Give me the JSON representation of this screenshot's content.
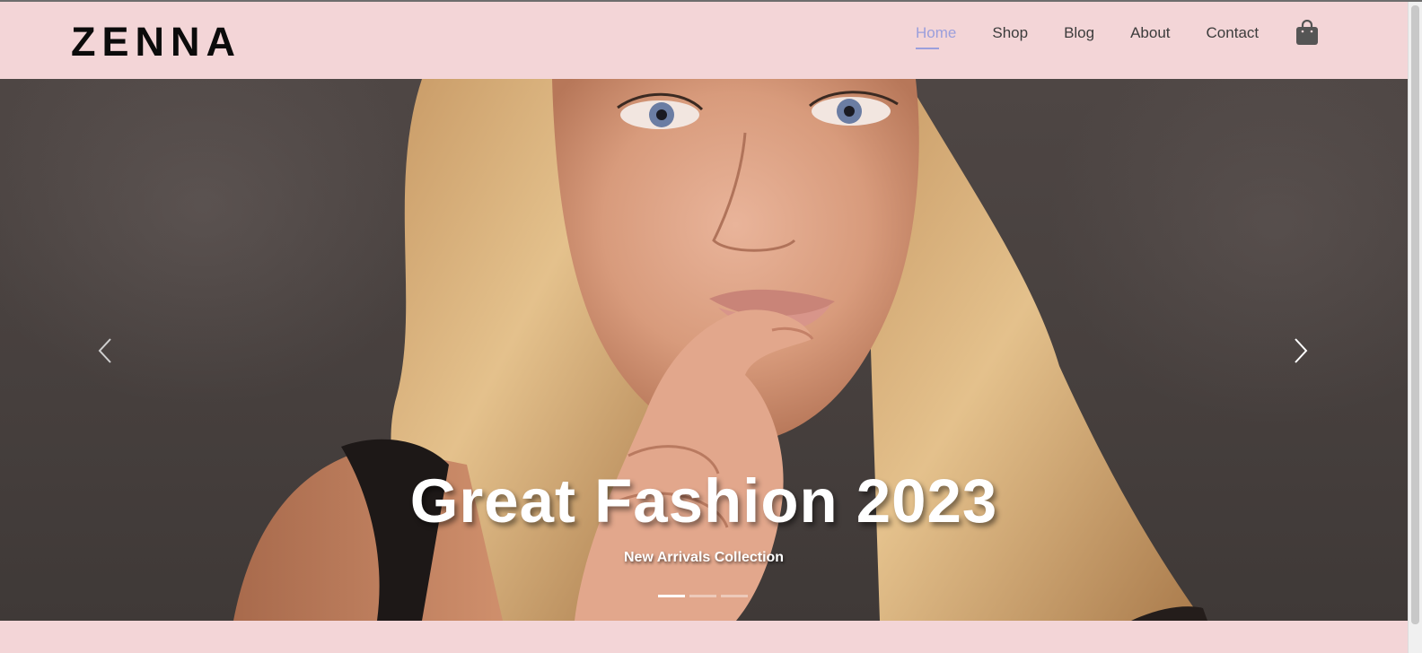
{
  "brand": {
    "logo_text": "ZENNA"
  },
  "nav": {
    "items": [
      {
        "label": "Home",
        "active": true
      },
      {
        "label": "Shop",
        "active": false
      },
      {
        "label": "Blog",
        "active": false
      },
      {
        "label": "About",
        "active": false
      },
      {
        "label": "Contact",
        "active": false
      }
    ],
    "cart_icon": "shopping-bag-icon"
  },
  "hero": {
    "title": "Great Fashion 2023",
    "subtitle": "New Arrivals Collection",
    "prev_icon": "chevron-left-icon",
    "next_icon": "chevron-right-icon",
    "slides_total": 3,
    "active_slide": 1
  },
  "colors": {
    "header_bg": "#f3d5d7",
    "nav_active": "#9b9fdc",
    "nav_text": "#3c3c3c",
    "logo": "#0b0b0b"
  }
}
